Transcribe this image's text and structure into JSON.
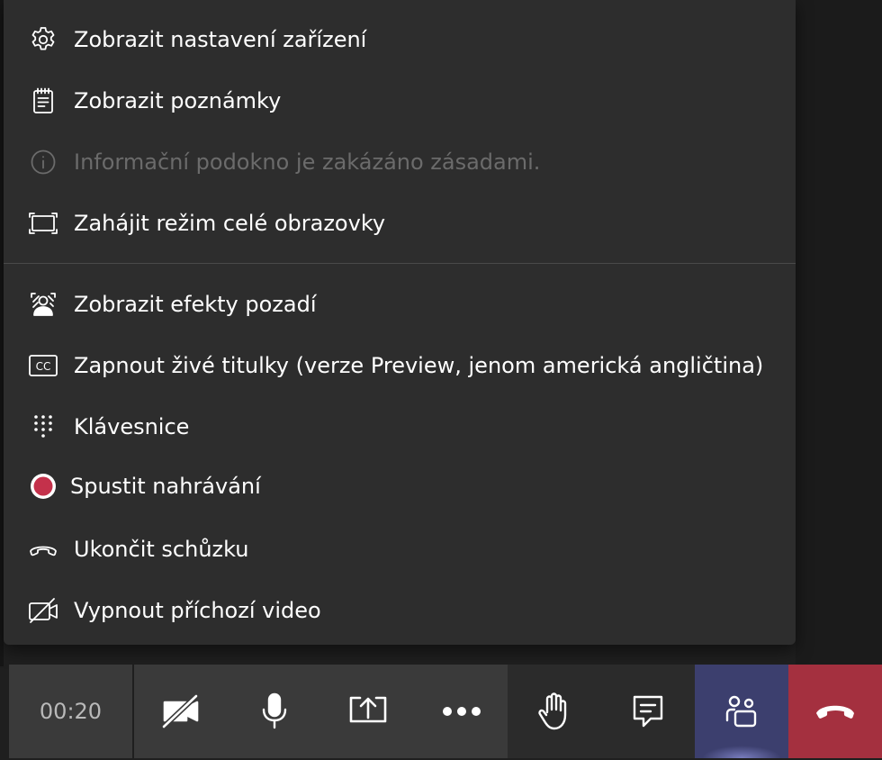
{
  "menu": {
    "items": [
      {
        "label": "Zobrazit nastavení zařízení",
        "icon": "gear-icon"
      },
      {
        "label": "Zobrazit poznámky",
        "icon": "notes-icon"
      },
      {
        "label": "Informační podokno je zakázáno zásadami.",
        "icon": "info-icon",
        "disabled": true
      },
      {
        "label": "Zahájit režim celé obrazovky",
        "icon": "fullscreen-icon"
      },
      {
        "label": "Zobrazit efekty pozadí",
        "icon": "background-effects-icon"
      },
      {
        "label": "Zapnout živé titulky (verze Preview, jenom americká angličtina)",
        "icon": "closed-captions-icon"
      },
      {
        "label": "Klávesnice",
        "icon": "dialpad-icon"
      },
      {
        "label": "Spustit nahrávání",
        "icon": "record-icon"
      },
      {
        "label": "Ukončit schůzku",
        "icon": "end-call-icon"
      },
      {
        "label": "Vypnout příchozí video",
        "icon": "video-off-icon"
      }
    ]
  },
  "toolbar": {
    "timer": "00:20",
    "buttons": [
      {
        "icon": "camera-off-icon"
      },
      {
        "icon": "microphone-icon"
      },
      {
        "icon": "share-screen-icon"
      },
      {
        "icon": "more-options-icon"
      },
      {
        "icon": "raise-hand-icon"
      },
      {
        "icon": "chat-icon"
      },
      {
        "icon": "participants-icon"
      },
      {
        "icon": "hang-up-icon"
      }
    ]
  },
  "colors": {
    "menu_background": "#2d2d2d",
    "disabled_text": "#6b6b6b",
    "record_red": "#c4314b",
    "participants_active": "#3c3f6e",
    "hang_up": "#a4303f"
  }
}
